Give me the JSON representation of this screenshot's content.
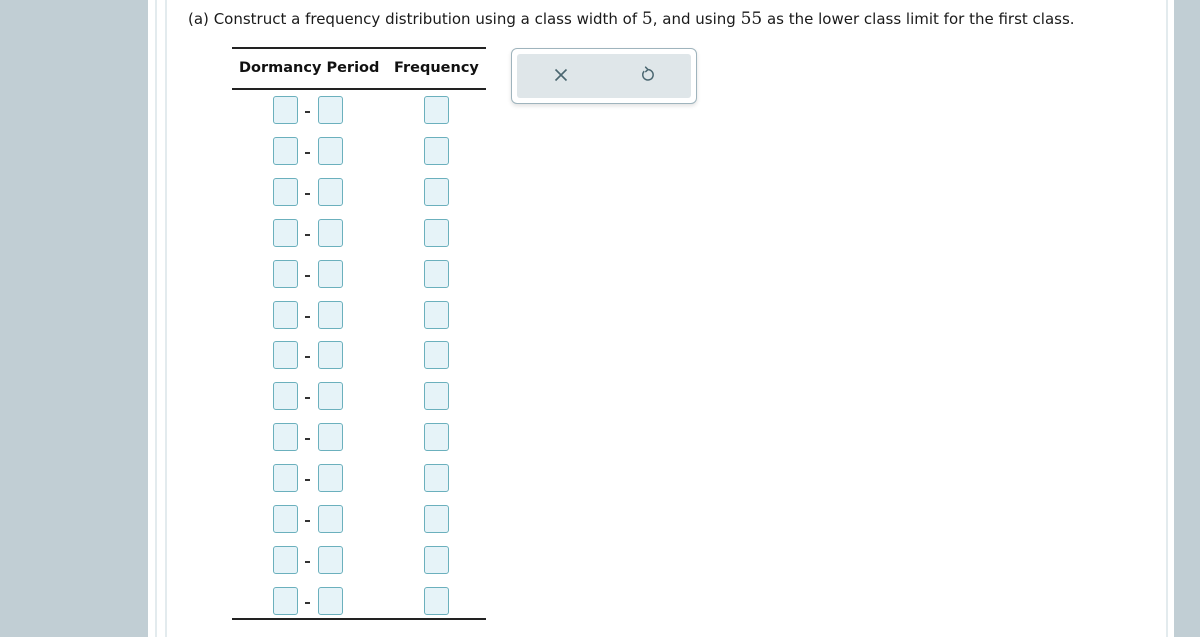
{
  "question": {
    "part": "(a)",
    "text_before_width": "Construct a frequency distribution using a class width of ",
    "class_width": "5",
    "text_middle": ", and using ",
    "lower_limit": "55",
    "text_after": " as the lower class limit for the first class."
  },
  "table": {
    "headers": {
      "period": "Dormancy Period",
      "frequency": "Frequency"
    },
    "row_count": 13,
    "separator": "-",
    "rows": [
      {
        "lower": "",
        "upper": "",
        "frequency": ""
      },
      {
        "lower": "",
        "upper": "",
        "frequency": ""
      },
      {
        "lower": "",
        "upper": "",
        "frequency": ""
      },
      {
        "lower": "",
        "upper": "",
        "frequency": ""
      },
      {
        "lower": "",
        "upper": "",
        "frequency": ""
      },
      {
        "lower": "",
        "upper": "",
        "frequency": ""
      },
      {
        "lower": "",
        "upper": "",
        "frequency": ""
      },
      {
        "lower": "",
        "upper": "",
        "frequency": ""
      },
      {
        "lower": "",
        "upper": "",
        "frequency": ""
      },
      {
        "lower": "",
        "upper": "",
        "frequency": ""
      },
      {
        "lower": "",
        "upper": "",
        "frequency": ""
      },
      {
        "lower": "",
        "upper": "",
        "frequency": ""
      },
      {
        "lower": "",
        "upper": "",
        "frequency": ""
      }
    ]
  },
  "actions": {
    "clear_icon": "close-icon",
    "reset_icon": "undo-icon"
  },
  "colors": {
    "side_panel": "#c1ced4",
    "input_border": "#6bb0bd",
    "input_fill": "#e6f3f8",
    "button_bg": "#dfe6e9",
    "icon_color": "#4a6670"
  }
}
